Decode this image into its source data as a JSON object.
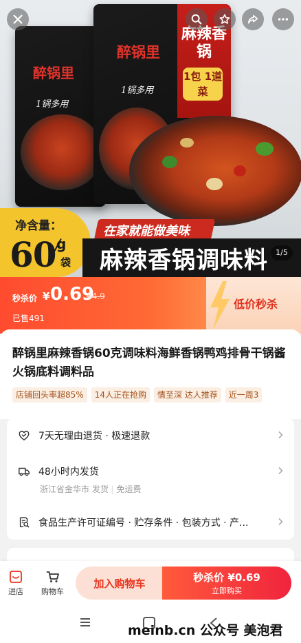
{
  "hero": {
    "package_brand": "醉锅里",
    "package_slogan": "1锅多用",
    "package_red_title": "麻辣香锅",
    "package_red_badge": "1包 1道菜",
    "net_content_label": "净含量：",
    "net_content_value": "60",
    "net_content_unit_g": "g",
    "net_content_unit_bag": "袋",
    "tagline": "在家就能做美味",
    "big_title": "麻辣香锅调味料",
    "image_index": "1/5"
  },
  "top_buttons": [
    "close-icon",
    "search-icon",
    "star-icon",
    "share-icon",
    "more-icon"
  ],
  "price": {
    "flash_label": "秒杀价",
    "currency": "¥",
    "value": "0.69",
    "original": "¥4.9",
    "sold": "已售491",
    "promo_label": "低价秒杀"
  },
  "product": {
    "title": "醉锅里麻辣香锅60克调味料海鲜香锅鸭鸡排骨干锅酱火锅底料调料品",
    "tags": [
      "店铺回头率超85%",
      "14人正在抢购",
      "情至深 达人推荐",
      "近一周3"
    ]
  },
  "services": [
    {
      "text": "7天无理由退货 · 极速退款"
    },
    {
      "text": "48小时内发货",
      "sub_location": "浙江省金华市 发货",
      "sub_shipping": "免运费"
    },
    {
      "text": "食品生产许可证编号 · 贮存条件 · 包装方式 · 产..."
    }
  ],
  "bottom_bar": {
    "store_label": "进店",
    "cart_label": "购物车",
    "add_cart_label": "加入购物车",
    "buy_line1": "秒杀价 ¥0.69",
    "buy_line2": "立即购买"
  },
  "watermark": "meinb.cn 公众号 美泡君",
  "colors": {
    "accent_red": "#f0243d",
    "price_orange": "#ff4b2f",
    "tag_text": "#a3541d"
  }
}
